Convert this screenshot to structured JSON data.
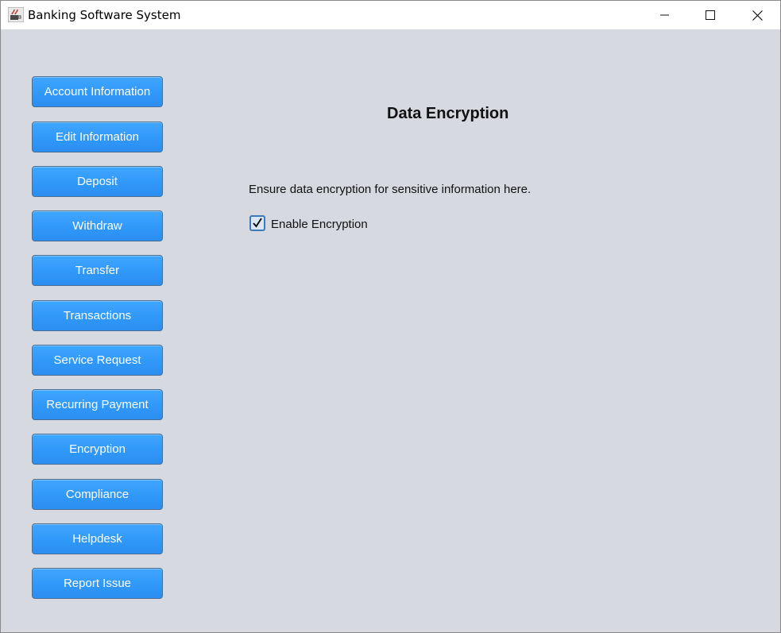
{
  "window": {
    "title": "Banking Software System",
    "app_icon": "java-coffee-icon"
  },
  "controls": {
    "minimize_icon": "minimize-icon",
    "maximize_icon": "maximize-icon",
    "close_icon": "close-icon"
  },
  "sidebar": {
    "items": [
      {
        "label": "Account Information"
      },
      {
        "label": "Edit Information"
      },
      {
        "label": "Deposit"
      },
      {
        "label": "Withdraw"
      },
      {
        "label": "Transfer"
      },
      {
        "label": "Transactions"
      },
      {
        "label": "Service Request"
      },
      {
        "label": "Recurring Payment"
      },
      {
        "label": "Encryption"
      },
      {
        "label": "Compliance"
      },
      {
        "label": "Helpdesk"
      },
      {
        "label": "Report Issue"
      }
    ]
  },
  "panel": {
    "title": "Data Encryption",
    "description": "Ensure data encryption for sensitive information here.",
    "checkbox": {
      "label": "Enable Encryption",
      "checked": true
    }
  },
  "colors": {
    "button": "#2f97f8",
    "background": "#d6d9df"
  }
}
